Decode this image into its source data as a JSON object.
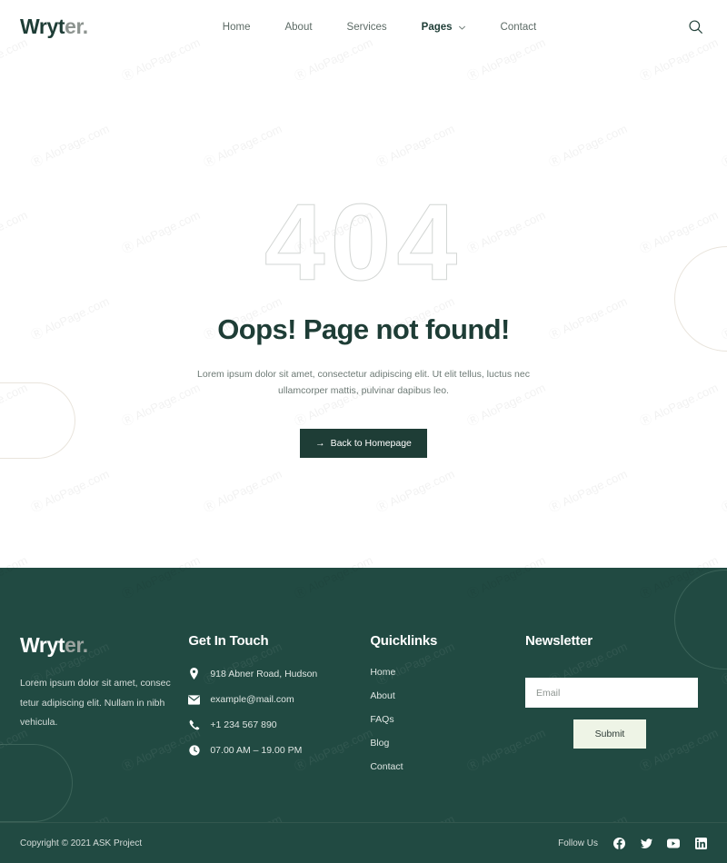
{
  "header": {
    "logo_main": "Wryt",
    "logo_light": "er",
    "logo_dot": ".",
    "nav": [
      {
        "label": "Home",
        "active": false
      },
      {
        "label": "About",
        "active": false
      },
      {
        "label": "Services",
        "active": false
      },
      {
        "label": "Pages",
        "active": true
      },
      {
        "label": "Contact",
        "active": false
      }
    ],
    "search_icon": "search-icon"
  },
  "hero": {
    "code": "404",
    "title": "Oops! Page not found!",
    "subtitle": "Lorem ipsum dolor sit amet, consectetur adipiscing elit. Ut elit tellus, luctus nec ullamcorper mattis, pulvinar dapibus leo.",
    "button_arrow": "→",
    "button_label": "Back to Homepage"
  },
  "footer": {
    "logo_main": "Wryt",
    "logo_light": "er.",
    "description": "Lorem ipsum dolor sit amet, consec tetur adipiscing elit. Nullam in nibh vehicula.",
    "contact": {
      "heading": "Get In Touch",
      "items": [
        {
          "icon": "location-pin-icon",
          "text": "918 Abner Road, Hudson"
        },
        {
          "icon": "envelope-icon",
          "text": "example@mail.com"
        },
        {
          "icon": "phone-icon",
          "text": "+1 234 567 890"
        },
        {
          "icon": "clock-icon",
          "text": "07.00 AM – 19.00 PM"
        }
      ]
    },
    "quicklinks": {
      "heading": "Quicklinks",
      "items": [
        "Home",
        "About",
        "FAQs",
        "Blog",
        "Contact"
      ]
    },
    "newsletter": {
      "heading": "Newsletter",
      "placeholder": "Email",
      "value": "",
      "submit_label": "Submit"
    }
  },
  "bottom": {
    "copyright": "Copyright © 2021 ASK Project",
    "follow_label": "Follow Us",
    "socials": [
      {
        "name": "facebook-icon"
      },
      {
        "name": "twitter-icon"
      },
      {
        "name": "youtube-icon"
      },
      {
        "name": "linkedin-icon"
      }
    ]
  },
  "watermark": {
    "text": "Ⓡ AloPage.com"
  },
  "colors": {
    "brand_dark_green": "#1e3d36",
    "footer_green": "#214a42",
    "cream": "#eef4e6",
    "muted_text": "#6d7a75",
    "outline_gray": "#d3d6d4",
    "deco_beige": "#e9e4dc"
  }
}
